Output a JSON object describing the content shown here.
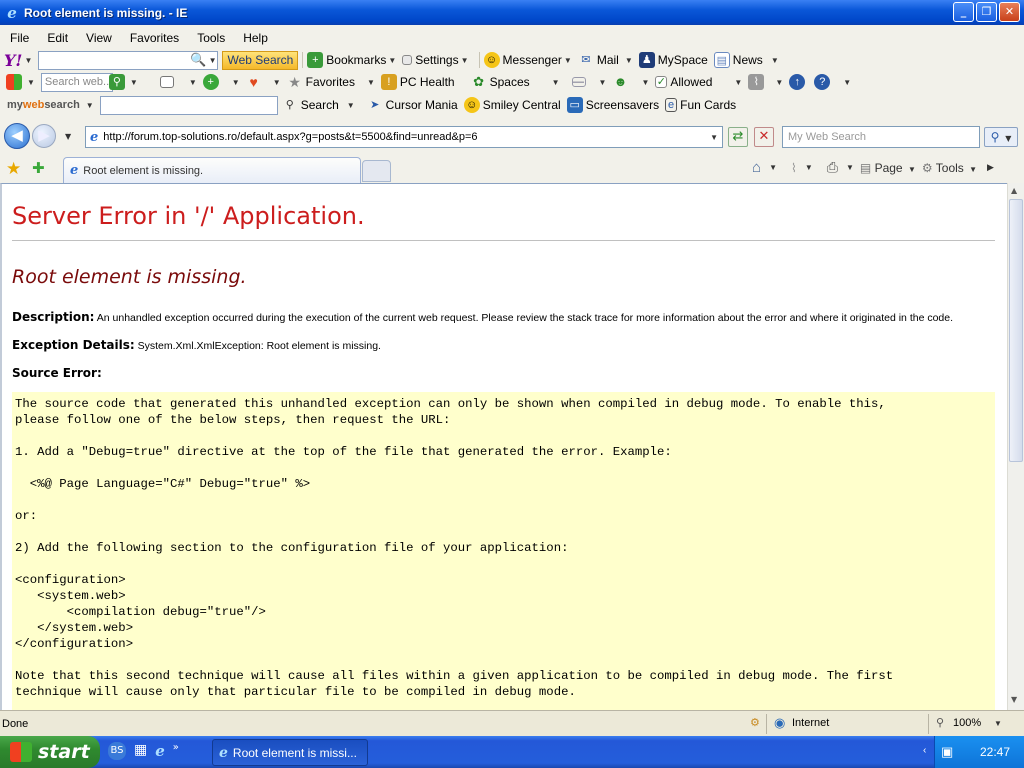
{
  "window": {
    "title": "Root element is missing. - IE"
  },
  "menu": [
    "File",
    "Edit",
    "View",
    "Favorites",
    "Tools",
    "Help"
  ],
  "toolbar1": {
    "logo": "Y!",
    "web_search": "Web Search",
    "bookmarks": "Bookmarks",
    "settings": "Settings",
    "messenger": "Messenger",
    "mail": "Mail",
    "myspace": "MySpace",
    "news": "News"
  },
  "toolbar2": {
    "search_placeholder": "Search web...",
    "favorites": "Favorites",
    "pc_health": "PC Health",
    "spaces": "Spaces",
    "allowed": "Allowed"
  },
  "toolbar3": {
    "logo_my": "my",
    "logo_web": "web",
    "logo_search": "search",
    "search": "Search",
    "cursor_mania": "Cursor Mania",
    "smiley_central": "Smiley Central",
    "screensavers": "Screensavers",
    "fun_cards": "Fun Cards"
  },
  "address": {
    "url": "http://forum.top-solutions.ro/default.aspx?g=posts&t=5500&find=unread&p=6",
    "search_placeholder": "My Web Search"
  },
  "tabs": {
    "active": "Root element is missing.",
    "page": "Page",
    "tools": "Tools"
  },
  "page": {
    "heading": "Server Error in '/' Application.",
    "subheading": "Root element is missing.",
    "description_label": "Description:",
    "description_text": "An unhandled exception occurred during the execution of the current web request. Please review the stack trace for more information about the error and where it originated in the code.",
    "exception_label": "Exception Details:",
    "exception_text": "System.Xml.XmlException: Root element is missing.",
    "source_label": "Source Error:",
    "source_text": "The source code that generated this unhandled exception can only be shown when compiled in debug mode. To enable this,\nplease follow one of the below steps, then request the URL:\n\n1. Add a \"Debug=true\" directive at the top of the file that generated the error. Example:\n\n  <%@ Page Language=\"C#\" Debug=\"true\" %>\n\nor:\n\n2) Add the following section to the configuration file of your application:\n\n<configuration>\n   <system.web>\n       <compilation debug=\"true\"/>\n   </system.web>\n</configuration>\n\nNote that this second technique will cause all files within a given application to be compiled in debug mode. The first\ntechnique will cause only that particular file to be compiled in debug mode."
  },
  "status": {
    "left": "Done",
    "zone": "Internet",
    "zoom": "100%"
  },
  "taskbar": {
    "start": "start",
    "task": "Root element is missi...",
    "clock": "22:47"
  }
}
